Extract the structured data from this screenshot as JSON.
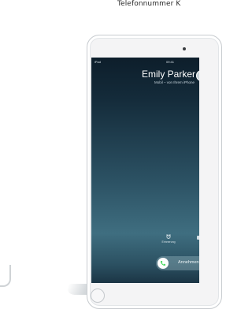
{
  "caption": "Telefonnummer K",
  "status_bar": {
    "carrier": "iPad",
    "time": "09:41"
  },
  "incoming_call": {
    "caller_name": "Emily Parker",
    "caller_subtitle": "Mobil – von Ihrem iPhone",
    "reminder_label": "Erinnerung",
    "answer_label": "Annehmen"
  },
  "icons": {
    "reminder": "alarm-clock-icon",
    "answer": "phone-icon",
    "message": "message-icon"
  },
  "colors": {
    "answer_green": "#4cd964",
    "screen_top": "#0d1e2b",
    "screen_mid": "#3f6e80"
  }
}
